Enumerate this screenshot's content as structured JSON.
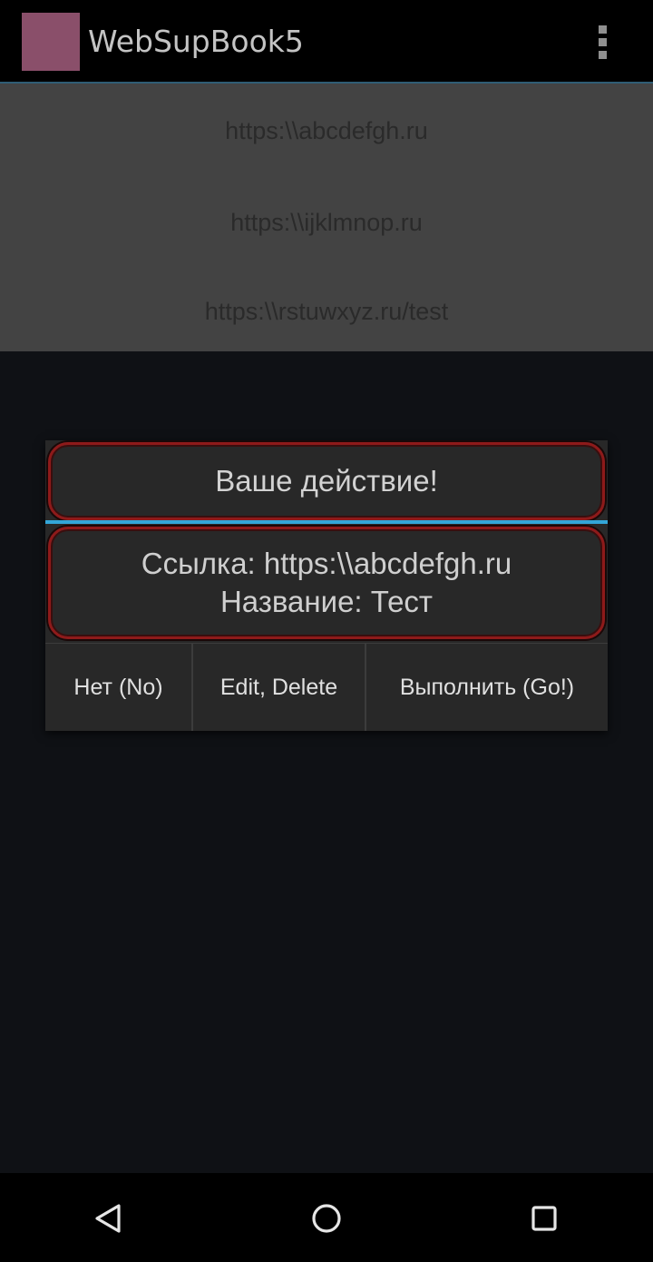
{
  "action_bar": {
    "title": "WebSupBook5",
    "icon_color": "#8a4f6a",
    "overflow_icon": "more-vert-icon"
  },
  "links": [
    {
      "url": "https:\\\\abcdefgh.ru"
    },
    {
      "url": "https:\\\\ijklmnop.ru"
    },
    {
      "url": "https:\\\\rstuwxyz.ru/test"
    }
  ],
  "dialog": {
    "title": "Ваше действие!",
    "message_line1": "Ссылка: https:\\\\abcdefgh.ru",
    "message_line2": "Название: Тест",
    "buttons": {
      "no": "Нет (No)",
      "edit": "Edit, Delete",
      "go": "Выполнить (Go!)"
    },
    "accent_color": "#33a6d8",
    "frame_color": "#8e1a1a"
  },
  "nav_bar": {
    "back_icon": "back-triangle-icon",
    "home_icon": "home-circle-icon",
    "recents_icon": "recents-square-icon"
  }
}
